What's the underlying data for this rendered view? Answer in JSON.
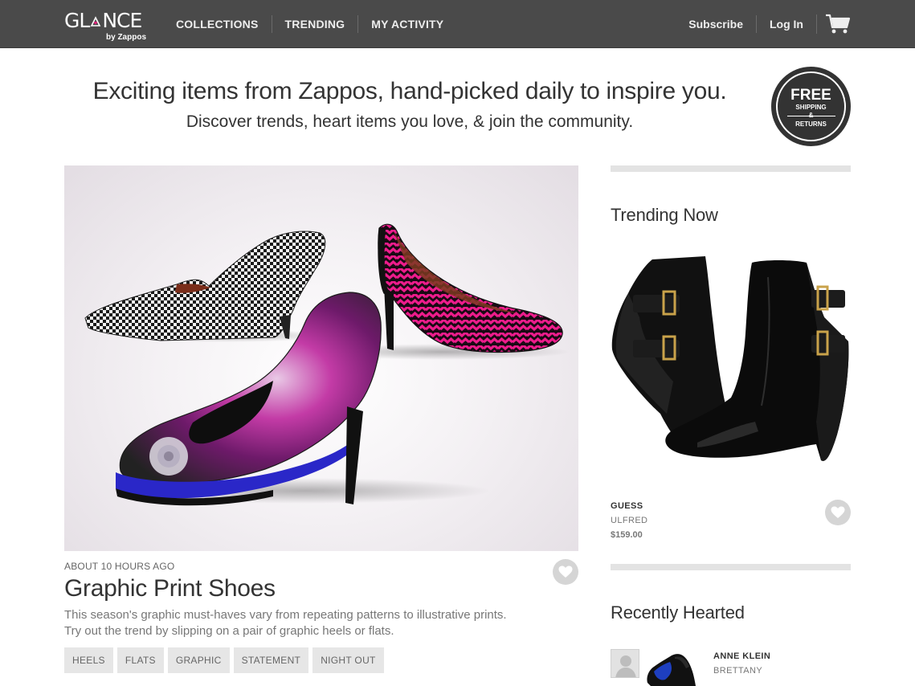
{
  "header": {
    "logo": {
      "wordmark": "GLANCE",
      "sub": "by Zappos"
    },
    "nav": [
      "COLLECTIONS",
      "TRENDING",
      "MY ACTIVITY"
    ],
    "right": {
      "subscribe": "Subscribe",
      "login": "Log In"
    },
    "cart_icon": "shopping-cart-icon"
  },
  "hero": {
    "headline": "Exciting items from Zappos, hand-picked daily to inspire you.",
    "subhead": "Discover trends, heart items you love, & join the community."
  },
  "badge": {
    "free": "FREE",
    "line1": "SHIPPING",
    "amp": "&",
    "line2": "RETURNS"
  },
  "feature": {
    "image": "graphic-print-shoes-photo",
    "timestamp": "ABOUT 10 HOURS AGO",
    "title": "Graphic Print Shoes",
    "description": "This season's graphic must-haves vary from repeating patterns to illustrative prints. Try out the trend by slipping on a pair of graphic heels or flats.",
    "tags": [
      "HEELS",
      "FLATS",
      "GRAPHIC",
      "STATEMENT",
      "NIGHT OUT"
    ]
  },
  "trending": {
    "title": "Trending Now",
    "image": "black-buckle-wedge-boots-photo",
    "brand": "GUESS",
    "name": "ULFRED",
    "price": "$159.00"
  },
  "recently_hearted": {
    "title": "Recently Hearted",
    "brand": "ANNE KLEIN",
    "name": "BRETTANY"
  },
  "colors": {
    "topbar": "#4a4a4a",
    "heart_button": "#d5d5d5",
    "tag_bg": "#e6e6e6",
    "divider": "#e3e3e3"
  }
}
